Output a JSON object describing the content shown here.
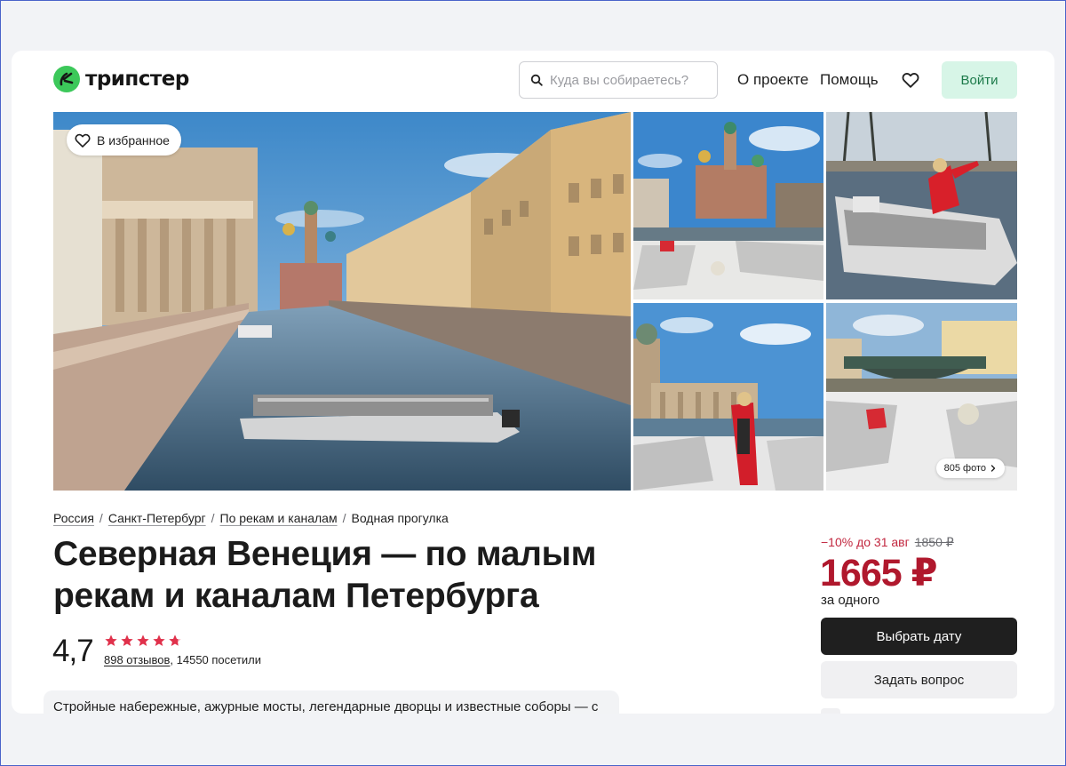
{
  "header": {
    "logo_text": "трипстер",
    "search_placeholder": "Куда вы собираетесь?",
    "nav_about": "О проекте",
    "nav_help": "Помощь",
    "login_label": "Войти"
  },
  "gallery": {
    "favorite_label": "В избранное",
    "photos_count_label": "805 фото"
  },
  "breadcrumbs": [
    "Россия",
    "Санкт-Петербург",
    "По рекам и каналам",
    "Водная прогулка"
  ],
  "title": "Северная Венеция — по малым рекам и каналам Петербурга",
  "rating": {
    "value": "4,7",
    "stars": 4.7,
    "reviews_link": "898 отзывов",
    "visitors": ", 14550 посетили"
  },
  "description_preview": "Стройные набережные, ажурные мосты, легендарные дворцы и известные соборы — с",
  "pricing": {
    "discount": "−10% до 31 авг",
    "old_price": "1850 ₽",
    "price": "1665 ₽",
    "per": "за одного",
    "select_date_label": "Выбрать дату",
    "ask_question_label": "Задать вопрос"
  },
  "colors": {
    "brand_green": "#3cc85a",
    "price_red": "#b0182d",
    "star_red": "#e0314b",
    "login_bg": "#d7f5e7"
  },
  "icons": {
    "search": "search-icon",
    "favorite": "heart-icon",
    "chevron": "chevron-right-icon"
  }
}
